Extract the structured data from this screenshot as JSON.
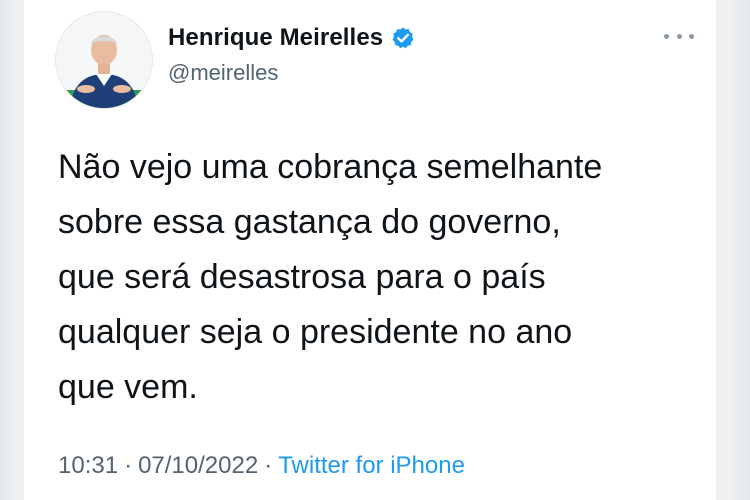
{
  "tweet": {
    "author": {
      "name": "Henrique Meirelles",
      "handle": "@meirelles",
      "verified": true,
      "avatar_icon": "profile-photo"
    },
    "more_icon": "more-options-icon",
    "text_lines": [
      "Não vejo uma cobrança semelhante",
      "sobre essa gastança do governo,",
      "que será desastrosa para o país",
      "qualquer seja o presidente no ano",
      "que vem."
    ],
    "time": "10:31",
    "separator": "·",
    "date": "07/10/2022",
    "source": "Twitter for iPhone"
  },
  "colors": {
    "text": "#0f1419",
    "secondary": "#536471",
    "link": "#1d9bf0",
    "verified_badge": "#1d9bf0"
  }
}
